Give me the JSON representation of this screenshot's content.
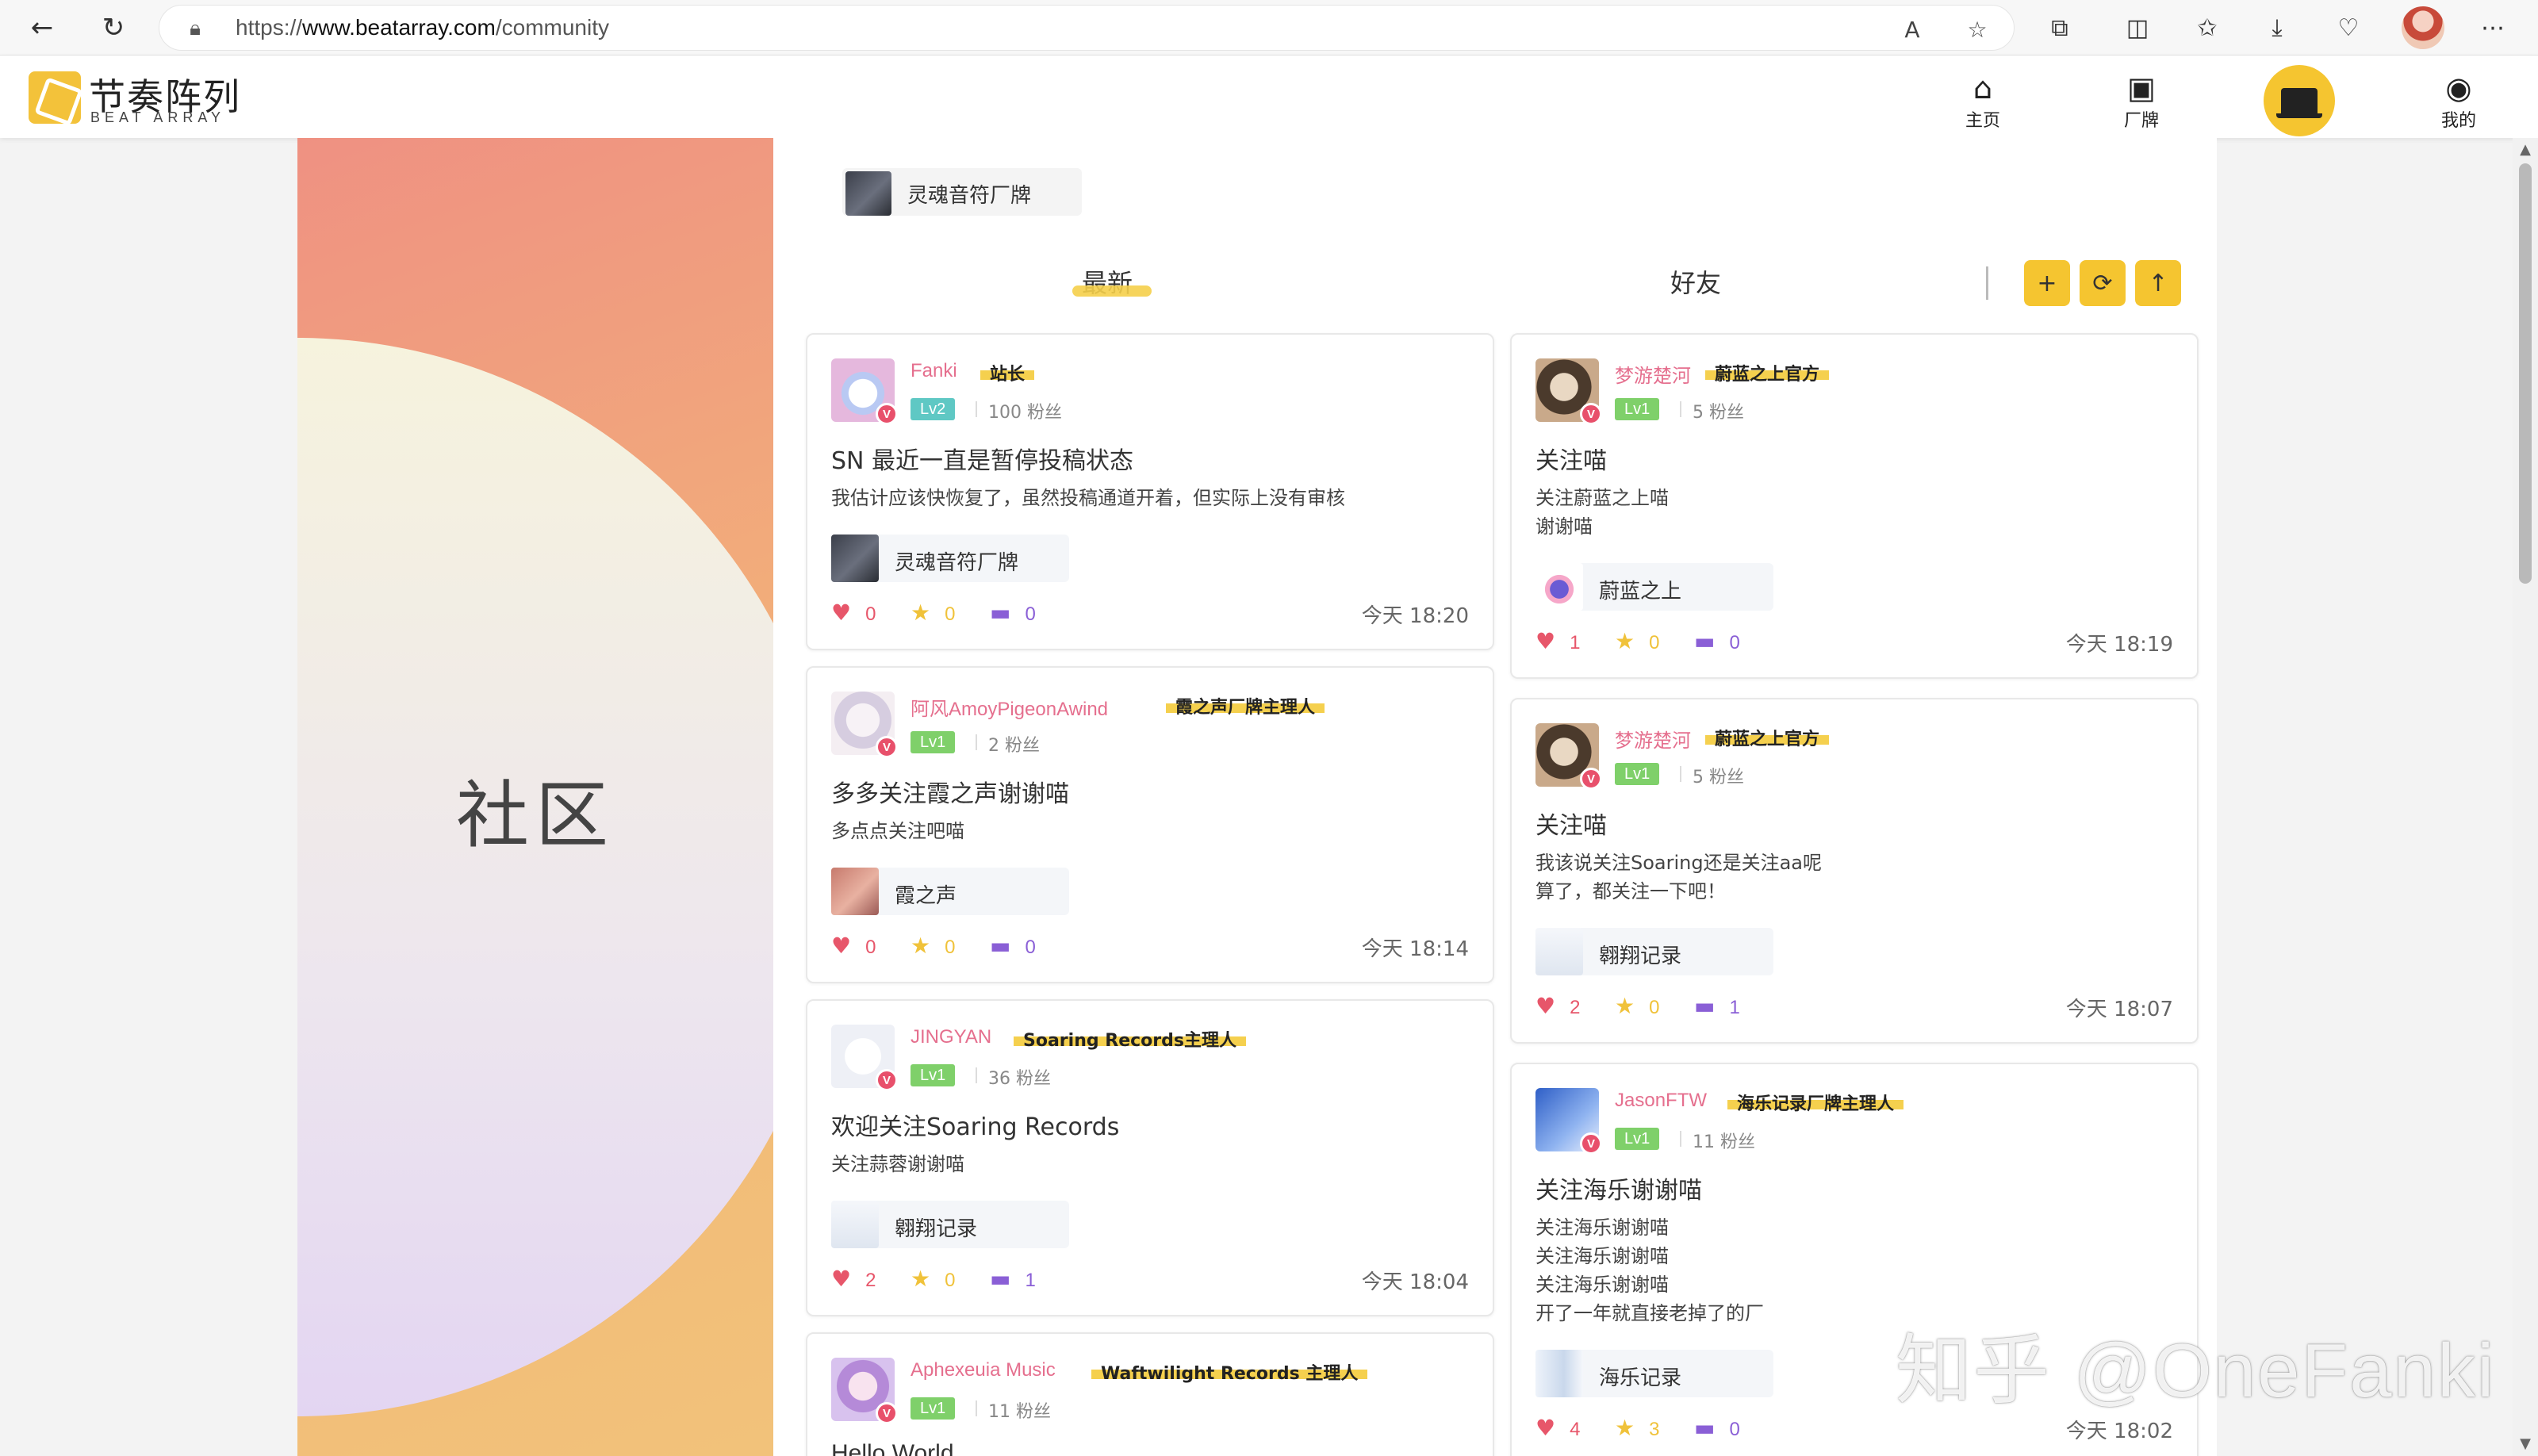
{
  "browser": {
    "url_prefix": "https://",
    "url_host": "www.beatarray.com",
    "url_path": "/community"
  },
  "site": {
    "logo_cn": "节奏阵列",
    "logo_en": "BEAT ARRAY",
    "nav": [
      {
        "label": "主页",
        "icon": "home-icon"
      },
      {
        "label": "厂牌",
        "icon": "speaker-icon"
      },
      {
        "label": "我的",
        "icon": "user-icon"
      }
    ]
  },
  "banner": {
    "title": "社区"
  },
  "filter_chip": {
    "label": "灵魂音符厂牌"
  },
  "tabs": [
    {
      "label": "最新",
      "active": true
    },
    {
      "label": "好友",
      "active": false
    }
  ],
  "actions": [
    "+",
    "⟳",
    "↑"
  ],
  "posts_left": [
    {
      "user": "Fanki",
      "title": "站长",
      "level": "Lv2",
      "fans": "100 粉丝",
      "post_title": "SN 最近一直是暂停投稿状态",
      "body": "我估计应该快恢复了，虽然投稿通道开着，但实际上没有审核",
      "brand": "灵魂音符厂牌",
      "likes": "0",
      "stars": "0",
      "comments": "0",
      "time": "今天 18:20"
    },
    {
      "user": "阿风AmoyPigeonAwind",
      "title": "霞之声厂牌主理人",
      "level": "Lv1",
      "fans": "2 粉丝",
      "post_title": "多多关注霞之声谢谢喵",
      "body": "多点点关注吧喵",
      "brand": "霞之声",
      "likes": "0",
      "stars": "0",
      "comments": "0",
      "time": "今天 18:14"
    },
    {
      "user": "JINGYAN",
      "title": "Soaring Records主理人",
      "level": "Lv1",
      "fans": "36 粉丝",
      "post_title": "欢迎关注Soaring Records",
      "body": "关注蒜蓉谢谢喵",
      "brand": "翱翔记录",
      "likes": "2",
      "stars": "0",
      "comments": "1",
      "time": "今天 18:04"
    },
    {
      "user": "Aphexeuia Music",
      "title": "Waftwilight Records 主理人",
      "level": "Lv1",
      "fans": "11 粉丝",
      "post_title": "Hello World"
    }
  ],
  "posts_right": [
    {
      "user": "梦游楚河",
      "title": "蔚蓝之上官方",
      "level": "Lv1",
      "fans": "5 粉丝",
      "post_title": "关注喵",
      "body": "关注蔚蓝之上喵\n谢谢喵",
      "brand": "蔚蓝之上",
      "likes": "1",
      "stars": "0",
      "comments": "0",
      "time": "今天 18:19"
    },
    {
      "user": "梦游楚河",
      "title": "蔚蓝之上官方",
      "level": "Lv1",
      "fans": "5 粉丝",
      "post_title": "关注喵",
      "body": "我该说关注Soaring还是关注aa呢\n算了，都关注一下吧！",
      "brand": "翱翔记录",
      "likes": "2",
      "stars": "0",
      "comments": "1",
      "time": "今天 18:07"
    },
    {
      "user": "JasonFTW",
      "title": "海乐记录厂牌主理人",
      "level": "Lv1",
      "fans": "11 粉丝",
      "post_title": "关注海乐谢谢喵",
      "body": "关注海乐谢谢喵\n关注海乐谢谢喵\n关注海乐谢谢喵\n开了一年就直接老掉了的厂",
      "brand": "海乐记录",
      "likes": "4",
      "stars": "3",
      "comments": "0",
      "time": "今天 18:02"
    }
  ],
  "watermark": "知乎 @OneFanki",
  "colors": {
    "accent": "#f5c530",
    "username": "#e56f8e",
    "level": "#7fd06a"
  }
}
